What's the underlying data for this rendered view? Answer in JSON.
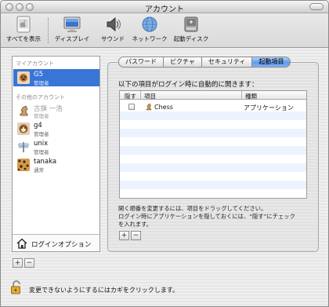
{
  "window": {
    "title": "アカウント"
  },
  "toolbar": {
    "items": [
      {
        "label": "すべてを表示",
        "icon": "apple-icon"
      },
      {
        "label": "ディスプレイ",
        "icon": "display-icon"
      },
      {
        "label": "サウンド",
        "icon": "speaker-icon"
      },
      {
        "label": "ネットワーク",
        "icon": "network-globe-icon"
      },
      {
        "label": "起動ディスク",
        "icon": "startup-disk-icon"
      }
    ]
  },
  "sidebar": {
    "my_account_header": "マイアカウント",
    "other_accounts_header": "その他のアカウント",
    "my_account": {
      "name": "G5",
      "role": "管理者"
    },
    "other_accounts": [
      {
        "name": "古旗 一浩",
        "role": "管理者"
      },
      {
        "name": "g4",
        "role": "管理者"
      },
      {
        "name": "unix",
        "role": "管理者"
      },
      {
        "name": "tanaka",
        "role": "通常"
      }
    ],
    "login_options_label": "ログインオプション",
    "add_label": "+",
    "remove_label": "−"
  },
  "tabs": [
    {
      "label": "パスワード",
      "active": false
    },
    {
      "label": "ピクチャ",
      "active": false
    },
    {
      "label": "セキュリティ",
      "active": false
    },
    {
      "label": "起動項目",
      "active": true
    }
  ],
  "login_items": {
    "intro": "以下の項目がログイン時に自動的に開きます：",
    "columns": {
      "hide": "隠す",
      "item": "項目",
      "kind": "種類"
    },
    "rows": [
      {
        "hide": false,
        "name": "Chess",
        "kind": "アプリケーション"
      }
    ],
    "hint_line1": "開く順番を変更するには、項目をドラッグしてください。",
    "hint_line2": "ログイン時にアプリケーションを隠しておくには、“隠す”にチェック",
    "hint_line3": "を入れます。",
    "add_label": "+",
    "remove_label": "−"
  },
  "footer": {
    "lock_text": "変更できないようにするにはカギをクリックします。"
  },
  "colors": {
    "selection": "#3875d7",
    "active_tab": "#5d9bee",
    "stripe": "#edf3fe"
  }
}
